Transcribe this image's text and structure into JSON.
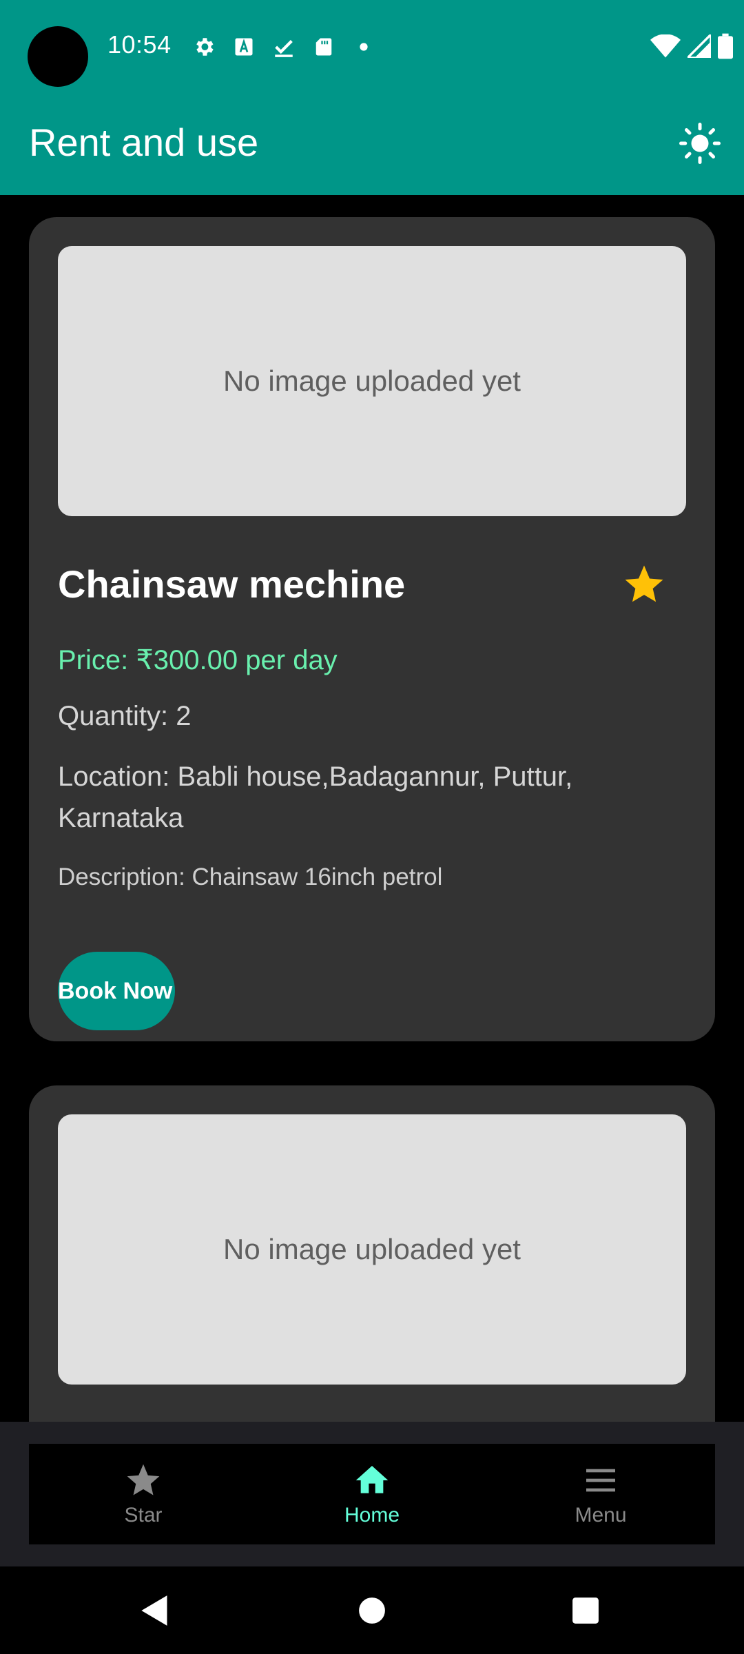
{
  "status_bar": {
    "time": "10:54",
    "left_icons": [
      "settings-icon",
      "a-icon",
      "download-check-icon",
      "sd-card-icon",
      "dot-icon"
    ],
    "right_icons": [
      "wifi-icon",
      "signal-icon",
      "battery-icon"
    ]
  },
  "app_bar": {
    "title": "Rent and use",
    "theme_icon": "sun-icon"
  },
  "items": [
    {
      "image_placeholder": "No image uploaded yet",
      "title": "Chainsaw mechine",
      "favorite_icon": "star-icon",
      "favorite_color": "#FFC107",
      "price": "Price: ₹300.00 per day",
      "quantity": "Quantity: 2",
      "location": "Location: Babli house,Badagannur, Puttur, Karnataka",
      "description": "Description: Chainsaw 16inch petrol",
      "book_label": "Book Now"
    },
    {
      "image_placeholder": "No image uploaded yet"
    }
  ],
  "bottom_nav": {
    "items": [
      {
        "label": "Star",
        "icon": "star-icon",
        "active": false
      },
      {
        "label": "Home",
        "icon": "home-icon",
        "active": true
      },
      {
        "label": "Menu",
        "icon": "menu-icon",
        "active": false
      }
    ],
    "active_color": "#64FFDA"
  },
  "colors": {
    "primary": "#009688",
    "price": "#69F0AE",
    "card": "#333333"
  }
}
